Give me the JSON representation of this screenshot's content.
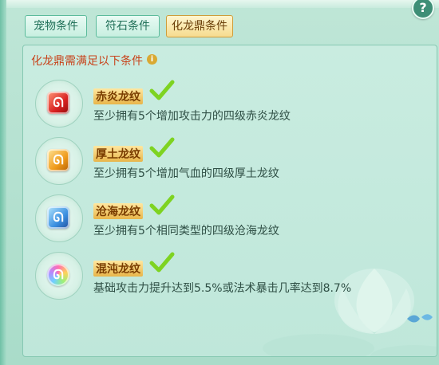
{
  "tabs": [
    {
      "label": "宠物条件",
      "active": false
    },
    {
      "label": "符石条件",
      "active": false
    },
    {
      "label": "化龙鼎条件",
      "active": true
    }
  ],
  "help_button": {
    "label": "?"
  },
  "panel": {
    "title": "化龙鼎需满足以下条件",
    "info_icon": "i",
    "requirements": [
      {
        "name": "赤炎龙纹",
        "desc": "至少拥有5个增加攻击力的四级赤炎龙纹",
        "gem_color": "#d82020",
        "icon": "red-dragon-gem-icon",
        "satisfied": true
      },
      {
        "name": "厚土龙纹",
        "desc": "至少拥有5个增加气血的四级厚土龙纹",
        "gem_color": "#ef9a1a",
        "icon": "orange-dragon-gem-icon",
        "satisfied": true
      },
      {
        "name": "沧海龙纹",
        "desc": "至少拥有5个相同类型的四级沧海龙纹",
        "gem_color": "#3a8fe0",
        "icon": "blue-dragon-gem-icon",
        "satisfied": true
      },
      {
        "name": "混沌龙纹",
        "desc": "基础攻击力提升达到5.5%或法术暴击几率达到8.7%",
        "gem_color": "#b38bff",
        "icon": "chaos-dragon-gem-icon",
        "satisfied": true
      }
    ]
  },
  "colors": {
    "title": "#c8431b",
    "check": "#7ed321",
    "active_tab": "#f6dc8f"
  }
}
